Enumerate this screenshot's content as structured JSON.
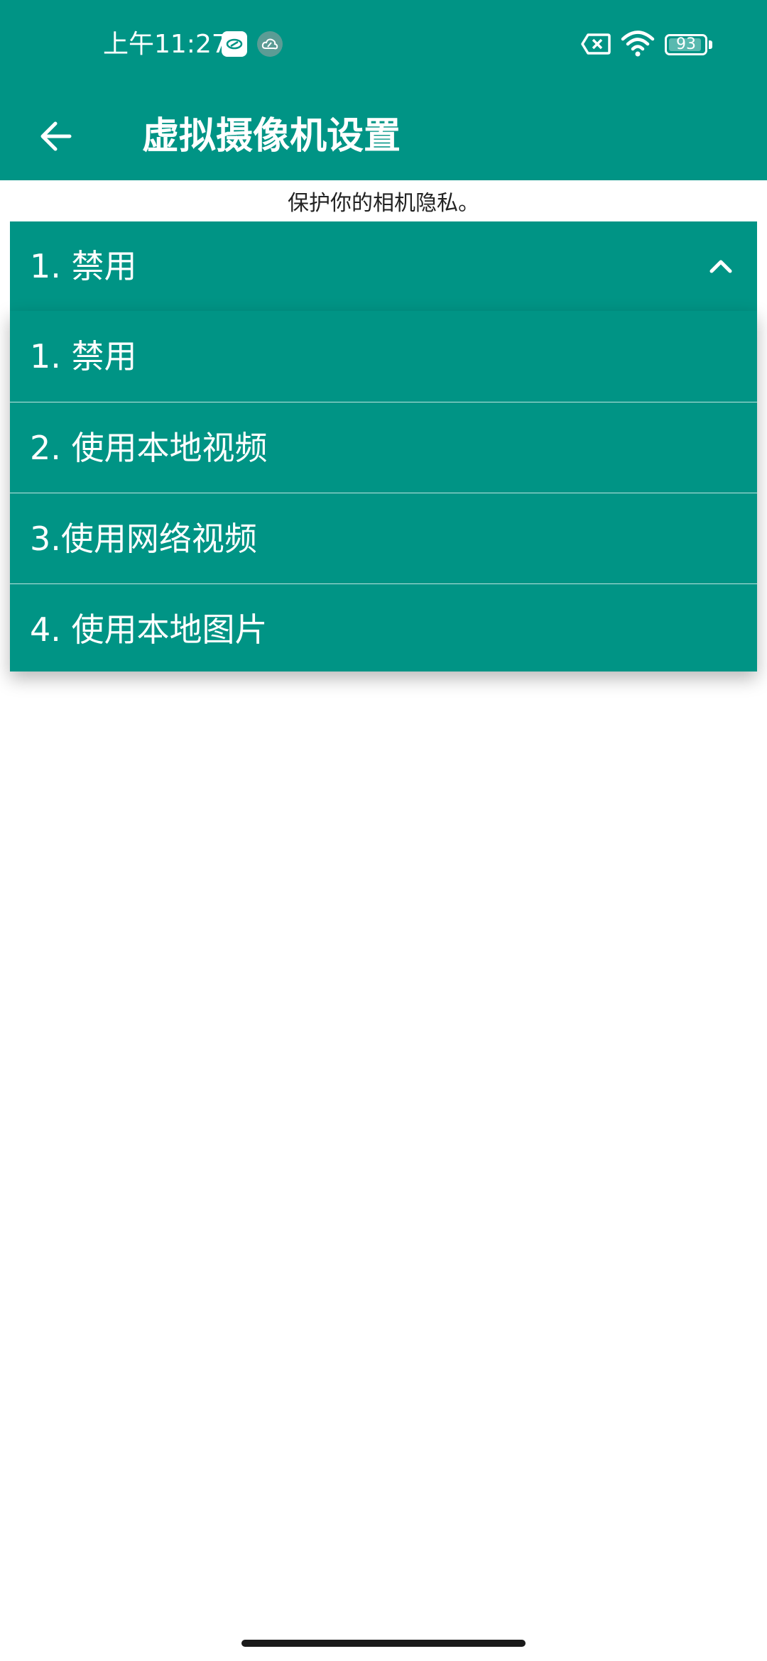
{
  "status_bar": {
    "time": "上午11:27",
    "battery": "93",
    "battery_level": 0.93,
    "icons": [
      "notification-app-icon",
      "cloud-notification-icon",
      "sim-absent-icon",
      "wifi-icon",
      "battery-icon"
    ]
  },
  "app_bar": {
    "title": "虚拟摄像机设置",
    "back_icon": "back-arrow-icon"
  },
  "subtitle": "保护你的相机隐私。",
  "dropdown": {
    "selected": "1. 禁用",
    "expanded": true,
    "chevron_icon": "chevron-up-icon",
    "options": [
      {
        "label": "1. 禁用"
      },
      {
        "label": "2. 使用本地视频"
      },
      {
        "label": "3.使用网络视频"
      },
      {
        "label": "4. 使用本地图片"
      }
    ]
  },
  "colors": {
    "primary": "#009485",
    "on_primary": "#ffffff",
    "background": "#ffffff"
  }
}
